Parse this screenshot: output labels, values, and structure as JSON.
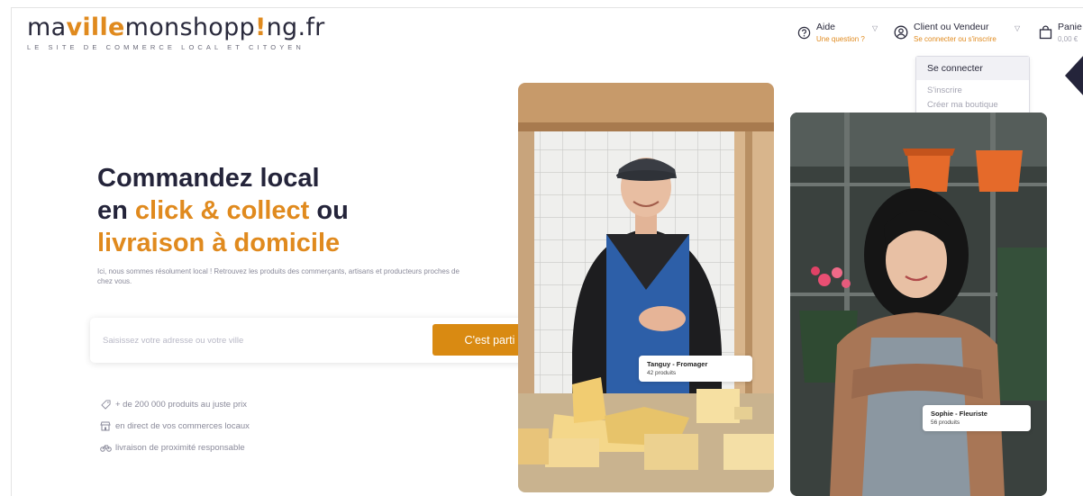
{
  "logo": {
    "part1": "ma",
    "part2": "ville",
    "part3": "monshopp",
    "part4": "!",
    "part5": "ng",
    "part6": ".fr",
    "tagline": "LE SITE DE COMMERCE LOCAL ET CITOYEN"
  },
  "header": {
    "help": {
      "title": "Aide",
      "subtitle": "Une question ?",
      "icon": "help-circle-icon"
    },
    "account": {
      "title": "Client ou Vendeur",
      "subtitle": "Se connecter ou s'inscrire",
      "icon": "user-circle-icon"
    },
    "cart": {
      "title": "Panie",
      "subtitle": "0,00 €",
      "icon": "shopping-bag-icon"
    }
  },
  "dropdown": {
    "items": [
      "Se connecter",
      "S'inscrire",
      "Créer ma boutique"
    ]
  },
  "hero": {
    "line1": "Commandez local",
    "line2_prefix": "en ",
    "line2_accent": "click & collect",
    "line2_suffix": " ou",
    "line3": "livraison à domicile",
    "subtitle": "Ici, nous sommes résolument local ! Retrouvez les produits des commerçants, artisans et producteurs proches de chez vous."
  },
  "search": {
    "placeholder": "Saisissez votre adresse ou votre ville",
    "button": "C'est parti"
  },
  "features": [
    {
      "icon": "tag-icon",
      "text": "+ de 200 000 produits au juste prix"
    },
    {
      "icon": "store-icon",
      "text": "en direct de vos commerces locaux"
    },
    {
      "icon": "bike-icon",
      "text": "livraison de proximité responsable"
    }
  ],
  "sellers": [
    {
      "name": "Tanguy - Fromager",
      "count": "42 produits"
    },
    {
      "name": "Sophie - Fleuriste",
      "count": "56 produits"
    }
  ],
  "colors": {
    "accent": "#d98a12",
    "dark": "#24243a",
    "muted": "#8a8a9a"
  }
}
